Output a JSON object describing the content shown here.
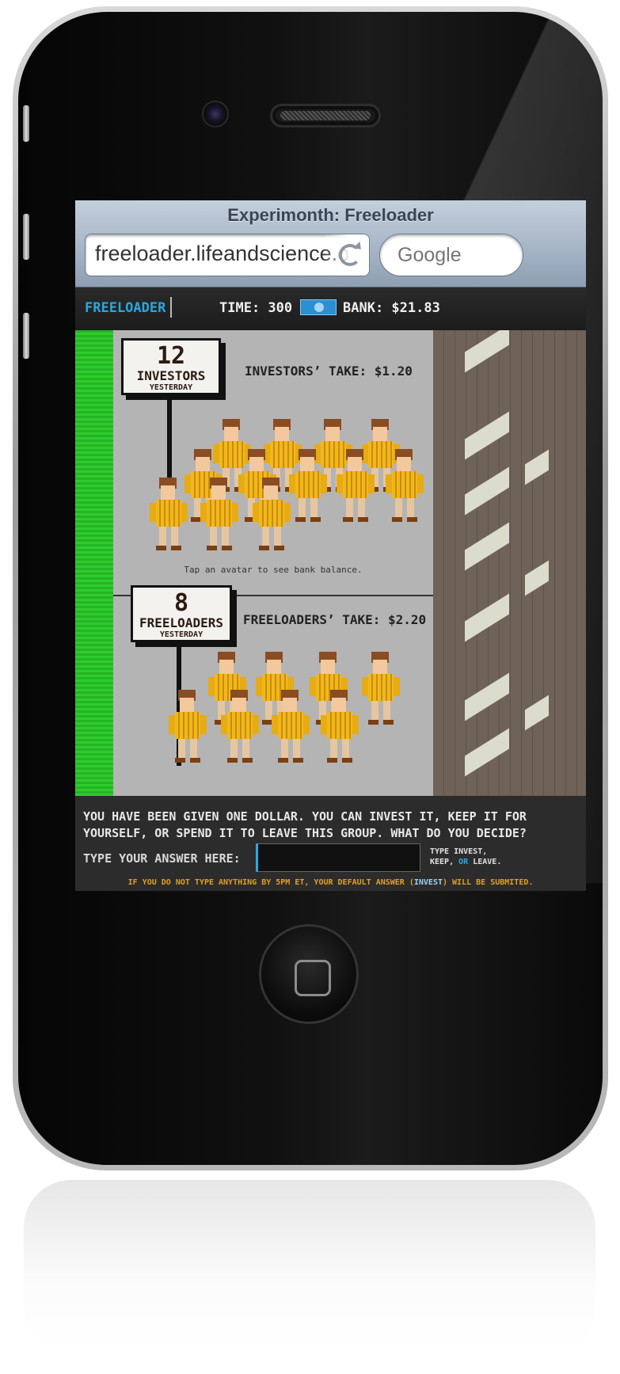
{
  "safari": {
    "title": "Experimonth: Freeloader",
    "url": "freeloader.lifeandscience.org",
    "search_placeholder": "Google"
  },
  "game_header": {
    "brand": "FREELOADER",
    "time": "TIME: 300",
    "bank": "BANK: $21.83"
  },
  "investors": {
    "count": "12",
    "label": "INVESTORS",
    "sub": "YESTERDAY",
    "take": "INVESTORS’ TAKE: $1.20",
    "avatar_count": 12
  },
  "hint": "Tap an avatar to see bank balance.",
  "freeloaders": {
    "count": "8",
    "label": "FREELOADERS",
    "sub": "YESTERDAY",
    "take": "FREELOADERS’ TAKE: $2.20",
    "avatar_count": 8
  },
  "panel": {
    "question": "YOU HAVE BEEN GIVEN ONE DOLLAR. YOU CAN INVEST IT, KEEP IT FOR YOURSELF, OR SPEND IT TO LEAVE THIS GROUP. WHAT DO YOU DECIDE?",
    "answer_label": "TYPE YOUR ANSWER HERE:",
    "answer_value": "",
    "hint_line1": "TYPE INVEST,",
    "hint_keep": "KEEP,",
    "hint_or": "OR",
    "hint_leave": "LEAVE.",
    "deadline_pre": "IF YOU DO NOT TYPE ANYTHING BY 5PM ET, YOUR DEFAULT ANSWER (",
    "deadline_default": "INVEST",
    "deadline_post": ") WILL BE SUBMITED."
  },
  "colors": {
    "brand": "#27a9e1",
    "grass": "#2ecc2e",
    "deadline": "#e0a023"
  },
  "icons": [
    "reload-icon",
    "dollar-bill-icon",
    "home-button-icon"
  ]
}
